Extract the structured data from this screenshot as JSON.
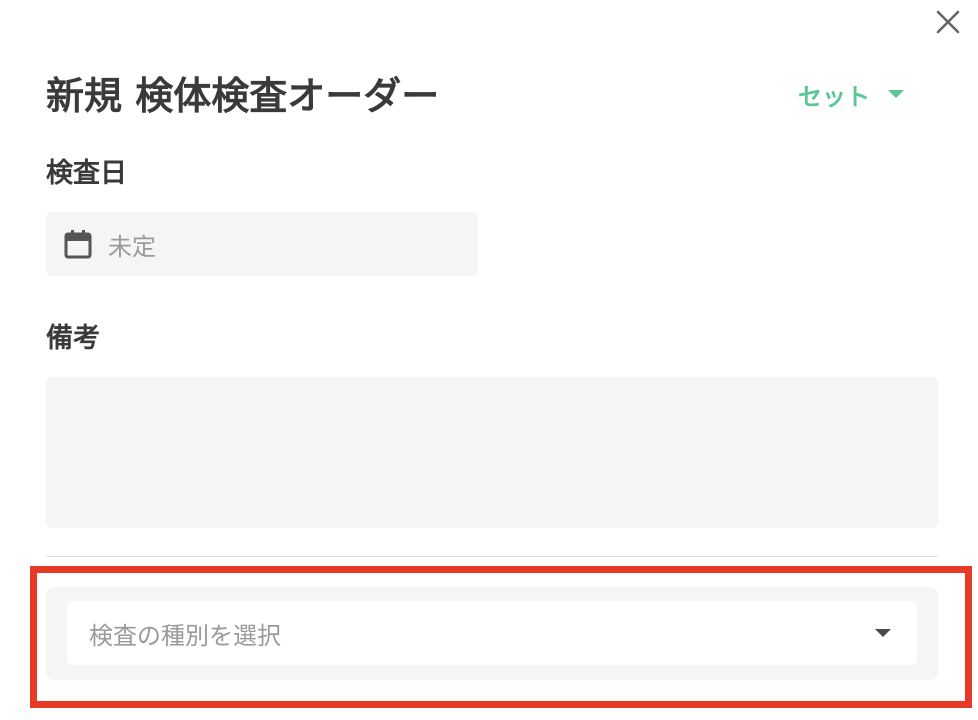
{
  "dialog": {
    "title": "新規 検体検査オーダー",
    "close_icon": "close-icon"
  },
  "set_menu": {
    "label": "セット",
    "icon": "caret-down-icon",
    "color": "#5cc795"
  },
  "form": {
    "date": {
      "label": "検査日",
      "value": "未定",
      "icon": "calendar-icon"
    },
    "note": {
      "label": "備考",
      "value": ""
    },
    "test_type": {
      "placeholder": "検査の種別を選択",
      "icon": "caret-down-icon"
    }
  },
  "highlight_color": "#e63a26"
}
